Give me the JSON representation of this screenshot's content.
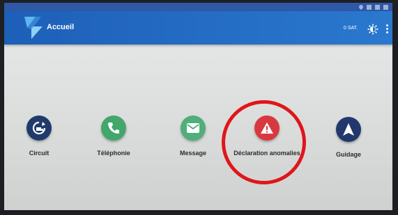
{
  "appbar": {
    "title": "Accueil",
    "sat_count": "0 SAT."
  },
  "menu": [
    {
      "id": "circuit",
      "label": "Circuit",
      "icon": "truck-refresh-icon",
      "color": "#1f3a6b"
    },
    {
      "id": "telephonie",
      "label": "Téléphonie",
      "icon": "phone-icon",
      "color": "#43a66b"
    },
    {
      "id": "message",
      "label": "Message",
      "icon": "mail-icon",
      "color": "#4fae7a"
    },
    {
      "id": "anomalies",
      "label": "Déclaration anomalies",
      "icon": "warning-triangle-icon",
      "color": "#d8393f"
    },
    {
      "id": "guidage",
      "label": "Guidage",
      "icon": "navigation-arrow-icon",
      "color": "#22386d"
    }
  ],
  "colors": {
    "appbar": "#2a78cf",
    "highlight": "#e0161a"
  }
}
